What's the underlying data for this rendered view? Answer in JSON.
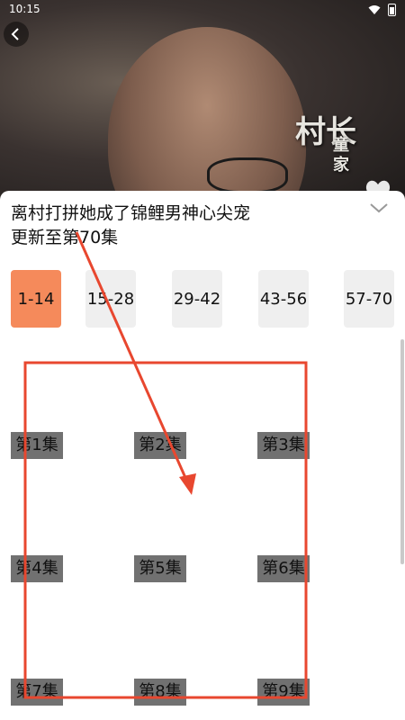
{
  "status_bar": {
    "time": "10:15"
  },
  "video": {
    "calligraphy_main": "村长",
    "calligraphy_small": "童家"
  },
  "panel": {
    "title": "离村打拼她成了锦鲤男神心尖宠",
    "update_status": "更新至第70集"
  },
  "range_tabs": [
    {
      "label": "1-14",
      "active": true
    },
    {
      "label": "15-28",
      "active": false
    },
    {
      "label": "29-42",
      "active": false
    },
    {
      "label": "43-56",
      "active": false
    },
    {
      "label": "57-70",
      "active": false
    }
  ],
  "episodes": [
    "第1集",
    "第2集",
    "第3集",
    "第4集",
    "第5集",
    "第6集",
    "第7集",
    "第8集",
    "第9集"
  ],
  "colors": {
    "accent": "#f58a5b",
    "annotation": "#e8472f",
    "tab_bg": "#efefef",
    "episode_bg": "#717171"
  },
  "icons": {
    "back": "chevron-left-icon",
    "like": "heart-icon",
    "collapse": "chevron-down-icon"
  }
}
